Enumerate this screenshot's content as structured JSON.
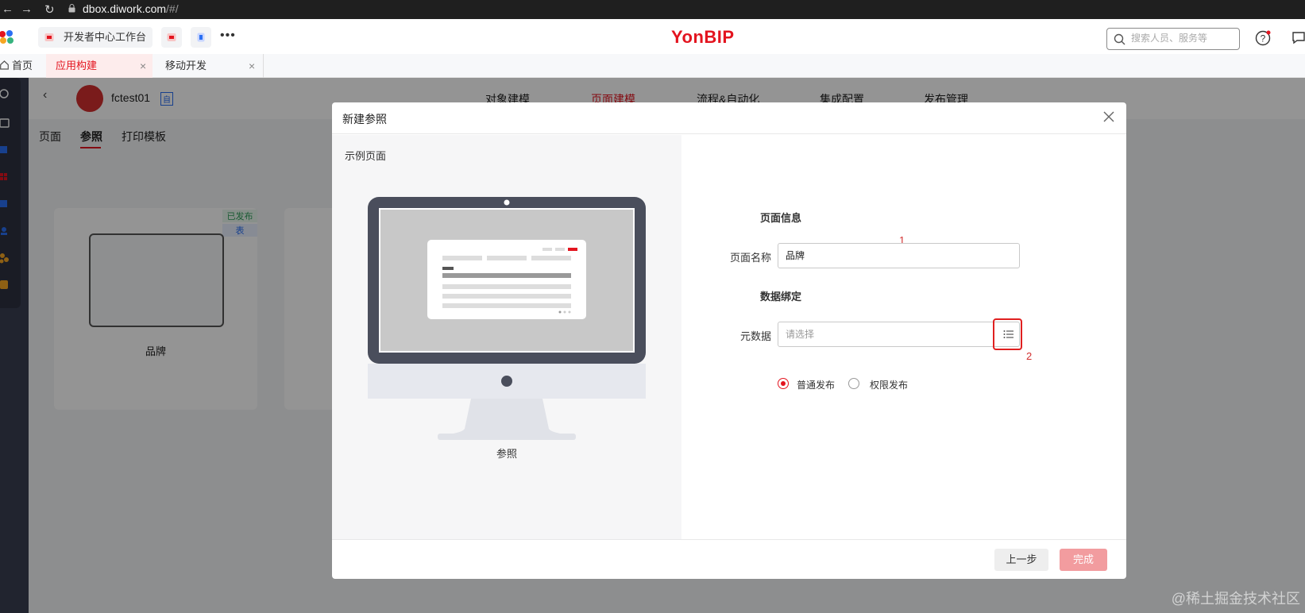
{
  "browser": {
    "url_host": "dbox.diwork.com",
    "url_path": "/#/"
  },
  "topbar": {
    "workbench_tab": "开发者中心工作台",
    "brand": "YonBIP",
    "search_placeholder": "搜索人员、服务等"
  },
  "workbench_tabs": [
    {
      "label": "首页"
    },
    {
      "label": "应用构建"
    },
    {
      "label": "移动开发"
    }
  ],
  "app": {
    "name": "fctest01",
    "badge": "自",
    "nav": [
      "对象建模",
      "页面建模",
      "流程&自动化",
      "集成配置",
      "发布管理"
    ],
    "subtabs": [
      "页面",
      "参照",
      "打印模板"
    ],
    "card": {
      "status": "已发布",
      "type": "表",
      "name": "品牌"
    }
  },
  "modal": {
    "title": "新建参照",
    "sample_title": "示例页面",
    "sample_label": "参照",
    "section_page_info": "页面信息",
    "page_name_label": "页面名称",
    "page_name_value": "品牌",
    "annotation_1": "1",
    "section_data_binding": "数据绑定",
    "metadata_label": "元数据",
    "metadata_placeholder": "请选择",
    "annotation_2": "2",
    "radio_normal": "普通发布",
    "radio_permission": "权限发布",
    "btn_prev": "上一步",
    "btn_done": "完成"
  },
  "watermark": "@稀土掘金技术社区",
  "colors": {
    "brand_red": "#e3141f",
    "done_button": "#f29c9f",
    "annotation_red": "#d23030"
  }
}
